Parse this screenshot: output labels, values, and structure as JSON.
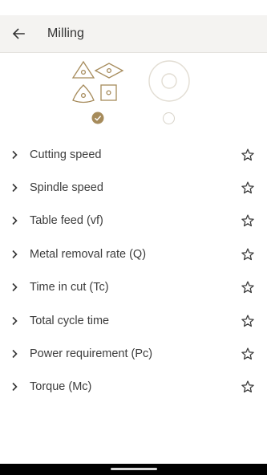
{
  "header": {
    "title": "Milling",
    "back_icon": "arrow-left-icon"
  },
  "accent_color": "#a68b5b",
  "text_color": "#3c3c3c",
  "insert_options": [
    {
      "name": "multi-shape-inserts",
      "selected": true
    },
    {
      "name": "round-insert",
      "selected": false
    }
  ],
  "calculations": [
    {
      "label": "Cutting speed"
    },
    {
      "label": "Spindle speed"
    },
    {
      "label": "Table feed (vf)"
    },
    {
      "label": "Metal removal rate (Q)"
    },
    {
      "label": "Time in cut (Tc)"
    },
    {
      "label": "Total cycle time"
    },
    {
      "label": "Power requirement (Pc)"
    },
    {
      "label": "Torque (Mc)"
    }
  ],
  "icons": {
    "row_left": "chevron-right-icon",
    "row_right": "star-outline-icon"
  }
}
